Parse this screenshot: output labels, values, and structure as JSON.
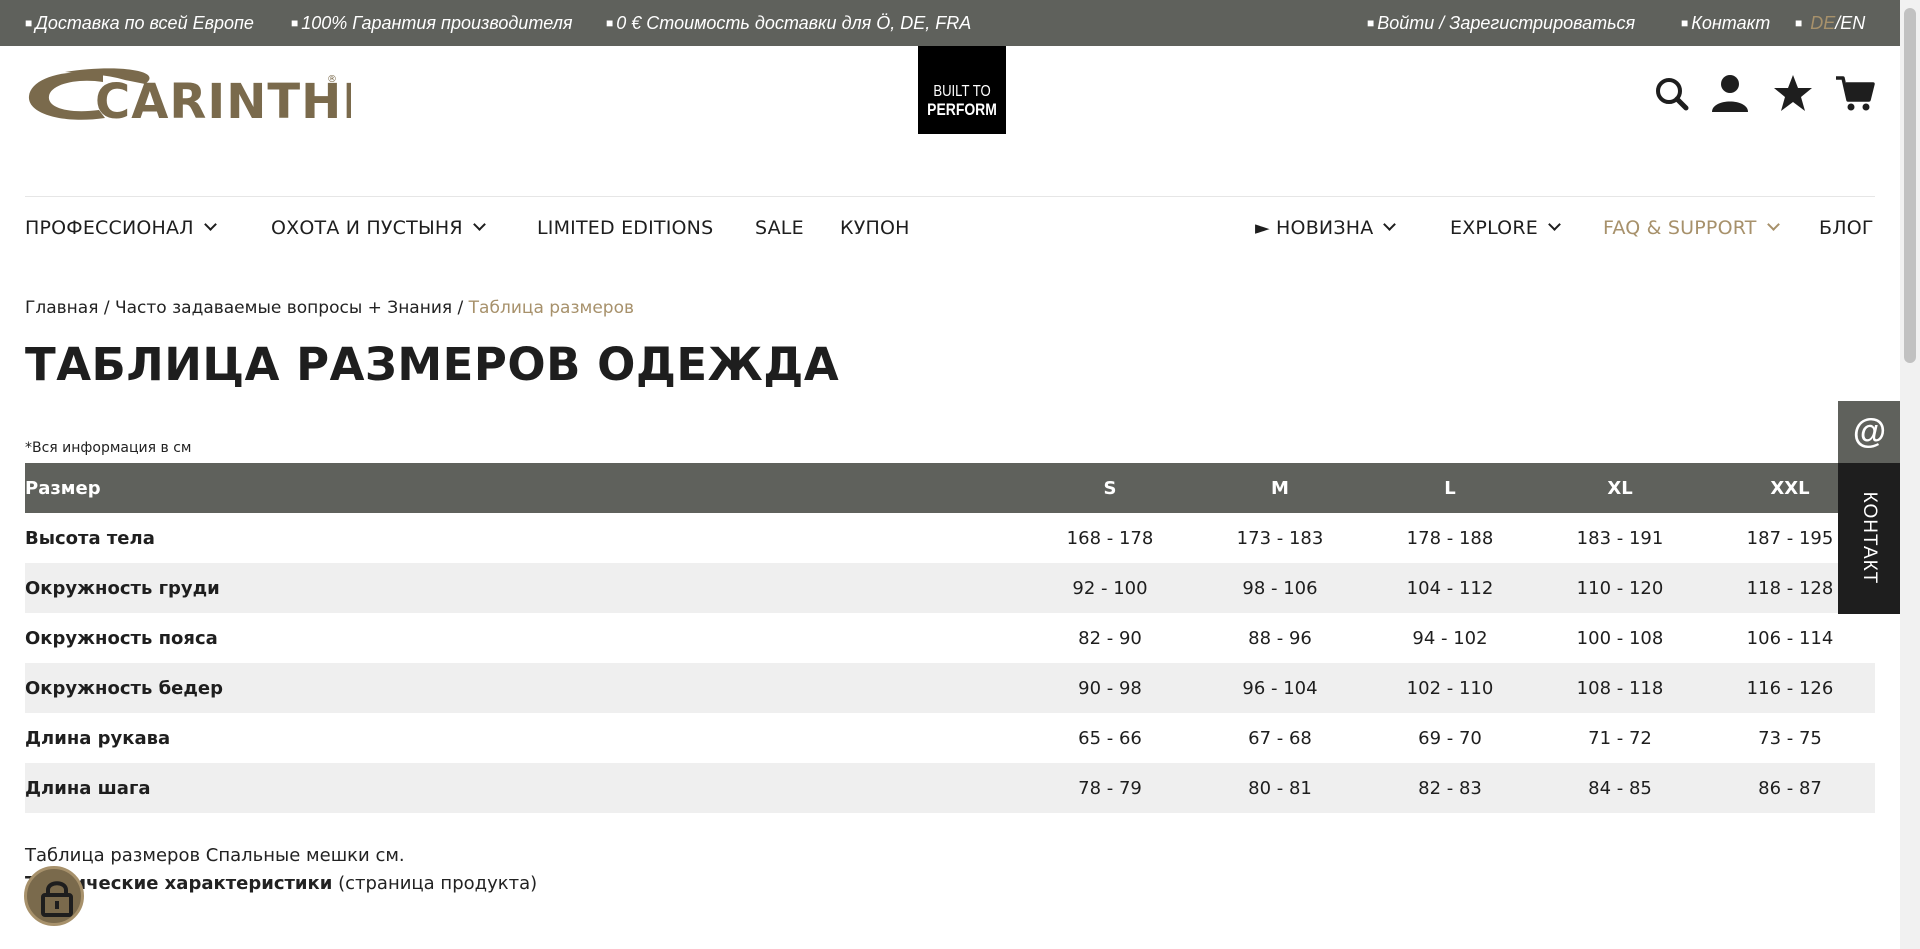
{
  "topbar": {
    "items": [
      "Доставка по всей Европе",
      "100% Гарантия производителя",
      "0 € Стоимость доставки для Ö, DE, FRA"
    ],
    "login": "Войти / Зарегистрироваться",
    "contact": "Контакт",
    "lang_de": "DE",
    "lang_sep": "/",
    "lang_en": "EN"
  },
  "header": {
    "logo_text": "CARINTHIA",
    "badge_line1": "BUILT TO",
    "badge_line2": "PERFORM",
    "icons": [
      "search-icon",
      "user-icon",
      "star-icon",
      "cart-icon"
    ]
  },
  "nav": {
    "left": [
      {
        "label": "ПРОФЕССИОНАЛ"
      },
      {
        "label": "ОХОТА И ПУСТЫНЯ"
      },
      {
        "label": "LIMITED EDITIONS"
      },
      {
        "label": "SALE"
      },
      {
        "label": "КУПОН"
      }
    ],
    "right": [
      {
        "label": "► НОВИЗНА"
      },
      {
        "label": "EXPLORE"
      },
      {
        "label": "FAQ & SUPPORT"
      },
      {
        "label": "БЛОГ"
      }
    ]
  },
  "breadcrumb": {
    "home": "Главная",
    "sep": " / ",
    "parent": "Часто задаваемые вопросы + Знания",
    "current": "Таблица размеров"
  },
  "page_title": "ТАБЛИЦА РАЗМЕРОВ ОДЕЖДА",
  "note": "*Вся информация в см",
  "table": {
    "header_label": "Размер",
    "sizes": [
      "S",
      "M",
      "L",
      "XL",
      "XXL"
    ],
    "rows": [
      {
        "label": "Высота тела",
        "values": [
          "168 - 178",
          "173 - 183",
          "178 - 188",
          "183 - 191",
          "187 - 195"
        ]
      },
      {
        "label": "Окружность груди",
        "values": [
          "92 - 100",
          "98 - 106",
          "104 - 112",
          "110 - 120",
          "118 - 128"
        ]
      },
      {
        "label": "Окружность пояса",
        "values": [
          "82 - 90",
          "88 - 96",
          "94 - 102",
          "100 - 108",
          "106 - 114"
        ]
      },
      {
        "label": "Окружность бедер",
        "values": [
          "90 - 98",
          "96 - 104",
          "102 - 110",
          "108 - 118",
          "116 - 126"
        ]
      },
      {
        "label": "Длина рукава",
        "values": [
          "65 - 66",
          "67 - 68",
          "69 - 70",
          "71 - 72",
          "73 - 75"
        ]
      },
      {
        "label": "Длина шага",
        "values": [
          "78 - 79",
          "80 - 81",
          "82 - 83",
          "84 - 85",
          "86 - 87"
        ]
      }
    ]
  },
  "links": {
    "sleeping_bags": "Таблица размеров Спальные мешки см.",
    "tech_strong": "Технические характеристики",
    "tech_rest": " (страница продукта)"
  },
  "side_tab": {
    "at": "@",
    "label": "КОНТАКТ"
  },
  "colors": {
    "topbar_bg": "#5f615c",
    "accent_gold": "#a7916b",
    "row_alt": "#efefef"
  }
}
